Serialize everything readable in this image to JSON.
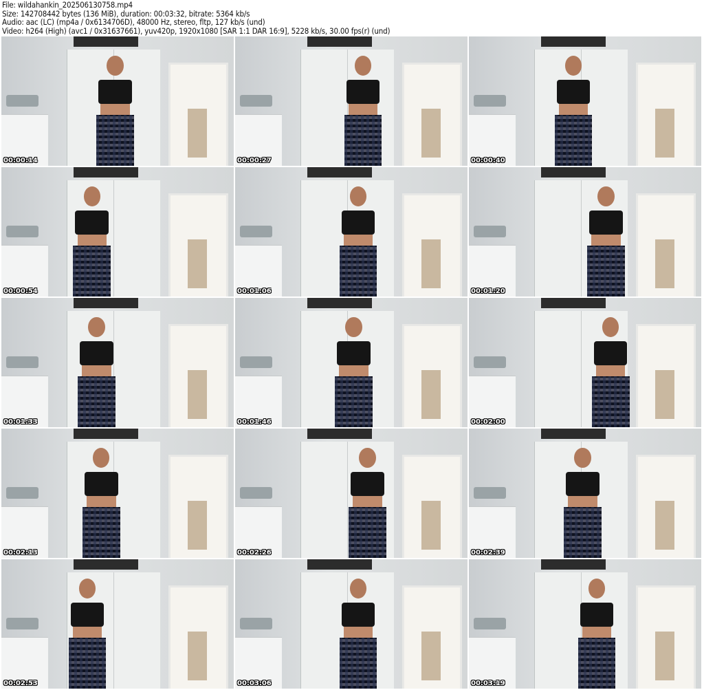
{
  "header": {
    "file": "File: wildahankin_202506130758.mp4",
    "size": "Size: 142708442 bytes (136 MiB), duration: 00:03:32, bitrate: 5364 kb/s",
    "audio": "Audio: aac (LC) (mp4a / 0x6134706D), 48000 Hz, stereo, fltp, 127 kb/s (und)",
    "video": "Video: h264 (High) (avc1 / 0x31637661), yuv420p, 1920x1080 [SAR 1:1 DAR 16:9], 5228 kb/s, 30.00 fps(r) (und)"
  },
  "thumbnails": [
    {
      "timestamp": "00:00:14"
    },
    {
      "timestamp": "00:00:27"
    },
    {
      "timestamp": "00:00:40"
    },
    {
      "timestamp": "00:00:54"
    },
    {
      "timestamp": "00:01:06"
    },
    {
      "timestamp": "00:01:20"
    },
    {
      "timestamp": "00:01:33"
    },
    {
      "timestamp": "00:01:46"
    },
    {
      "timestamp": "00:02:00"
    },
    {
      "timestamp": "00:02:13"
    },
    {
      "timestamp": "00:02:26"
    },
    {
      "timestamp": "00:02:39"
    },
    {
      "timestamp": "00:02:53"
    },
    {
      "timestamp": "00:03:06"
    },
    {
      "timestamp": "00:03:19"
    }
  ]
}
